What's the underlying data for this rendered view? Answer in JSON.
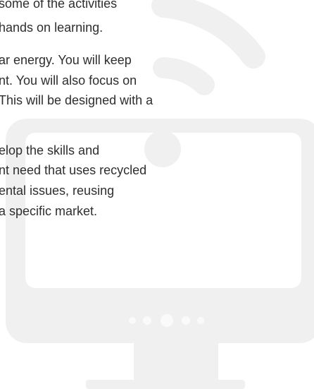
{
  "colors": {
    "text": "#2e2e2e",
    "watermark_fill": "#f0f0f0",
    "watermark_dots": "#fafafa",
    "background": "#ffffff"
  },
  "watermark": {
    "icon": "wifi-monitor-icon"
  },
  "text_lines": [
    "some of the activities",
    "hands on learning.",
    "ar energy. You will keep",
    "nt. You will also focus on",
    "This will be designed with a",
    "elop the skills and",
    "nt need that uses recycled",
    "ental issues, reusing",
    "a specific market."
  ]
}
